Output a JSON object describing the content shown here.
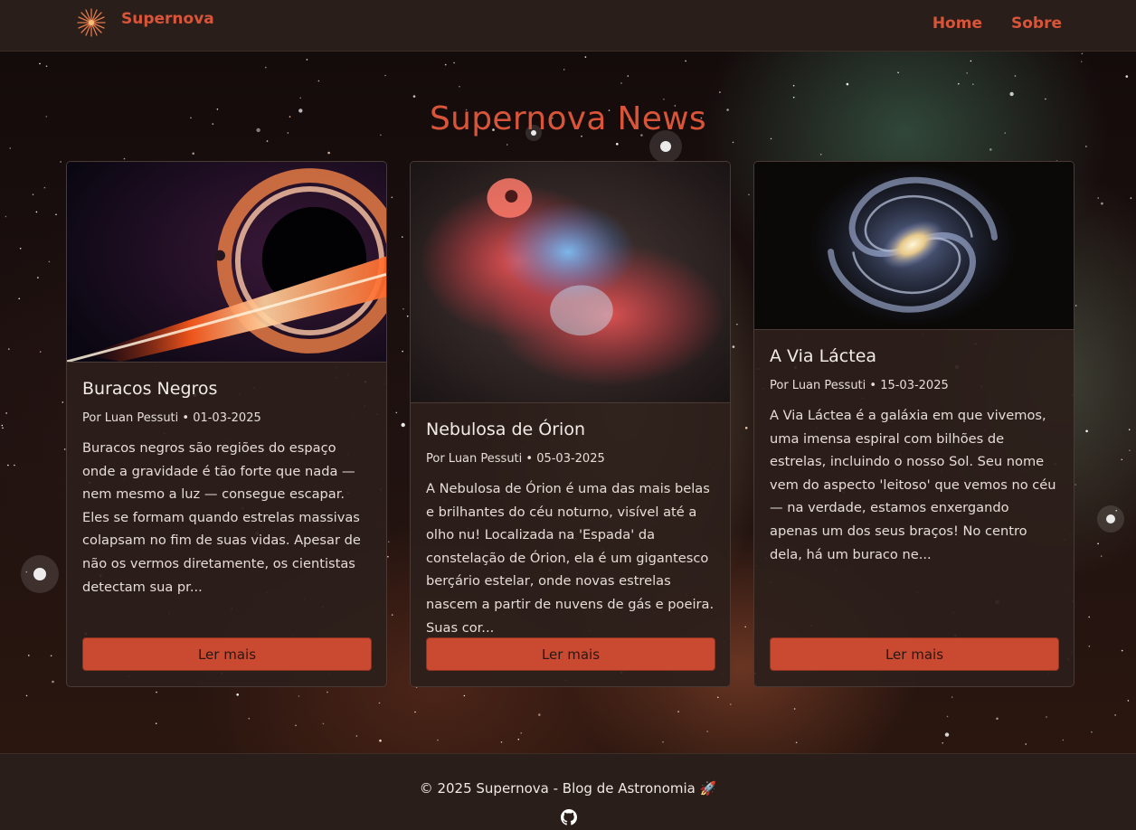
{
  "navbar": {
    "brand_name": "Supernova",
    "brand_icon": "starburst-icon",
    "links": [
      {
        "label": "Home"
      },
      {
        "label": "Sobre"
      }
    ]
  },
  "hero": {
    "title": "Supernova News"
  },
  "posts": [
    {
      "title": "Buracos Negros",
      "meta": "Por Luan Pessuti • 01-03-2025",
      "excerpt": "Buracos negros são regiões do espaço onde a gravidade é tão forte que nada — nem mesmo a luz — consegue escapar. Eles se formam quando estrelas massivas colapsam no fim de suas vidas. Apesar de não os vermos diretamente, os cientistas detectam sua pr...",
      "button_label": "Ler mais",
      "image": "black-hole-image"
    },
    {
      "title": "Nebulosa de Órion",
      "meta": "Por Luan Pessuti • 05-03-2025",
      "excerpt": "A Nebulosa de Órion é uma das mais belas e brilhantes do céu noturno, visível até a olho nu! Localizada na 'Espada' da constelação de Órion, ela é um gigantesco berçário estelar, onde novas estrelas nascem a partir de nuvens de gás e poeira. Suas cor...",
      "button_label": "Ler mais",
      "image": "orion-nebula-image"
    },
    {
      "title": "A Via Láctea",
      "meta": "Por Luan Pessuti • 15-03-2025",
      "excerpt": "A Via Láctea é a galáxia em que vivemos, uma imensa espiral com bilhões de estrelas, incluindo o nosso Sol. Seu nome vem do aspecto 'leitoso' que vemos no céu — na verdade, estamos enxergando apenas um dos seus braços! No centro dela, há um buraco ne...",
      "button_label": "Ler mais",
      "image": "milky-way-image"
    }
  ],
  "footer": {
    "text": "© 2025 Supernova - Blog de Astronomia 🚀",
    "github_icon": "github-icon"
  },
  "colors": {
    "accent": "#d9553a",
    "button": "#c94a31",
    "card_bg": "#2c1f1b",
    "nav_bg": "#2a1e1a"
  }
}
